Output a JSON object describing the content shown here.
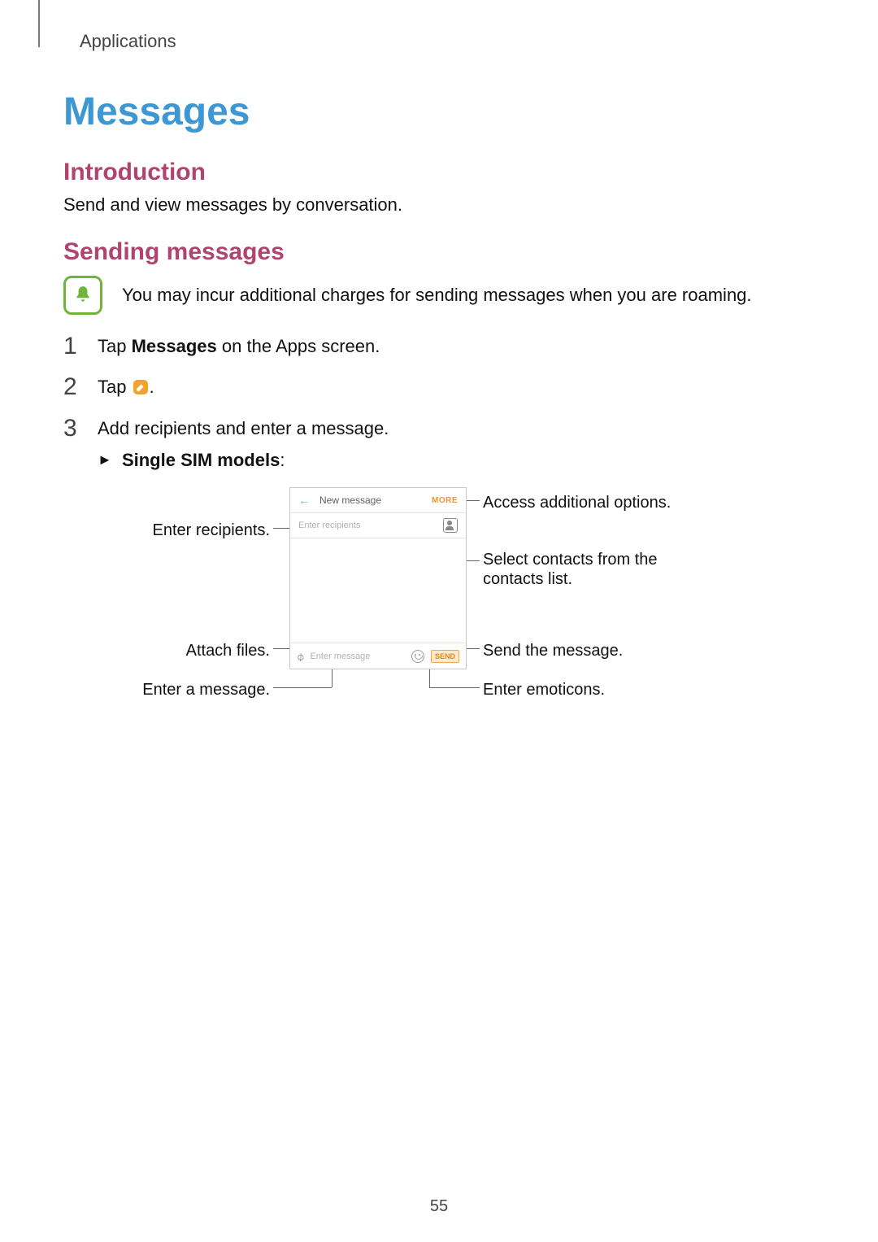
{
  "breadcrumb": "Applications",
  "h1": "Messages",
  "intro": {
    "heading": "Introduction",
    "body": "Send and view messages by conversation."
  },
  "sending": {
    "heading": "Sending messages",
    "note": "You may incur additional charges for sending messages when you are roaming.",
    "steps": {
      "s1": {
        "num": "1",
        "pre": "Tap ",
        "bold": "Messages",
        "post": " on the Apps screen."
      },
      "s2": {
        "num": "2",
        "pre": "Tap ",
        "post": "."
      },
      "s3": {
        "num": "3",
        "text": "Add recipients and enter a message."
      }
    },
    "sub": {
      "tri": "►",
      "bold": "Single SIM models",
      "colon": ":"
    }
  },
  "phone": {
    "title": "New message",
    "more": "MORE",
    "recipients_ph": "Enter recipients",
    "message_ph": "Enter message",
    "send": "SEND"
  },
  "callouts": {
    "enter_recipients": "Enter recipients.",
    "attach_files": "Attach files.",
    "enter_message": "Enter a message.",
    "more_options": "Access additional options.",
    "select_contacts_1": "Select contacts from the",
    "select_contacts_2": "contacts list.",
    "send_msg": "Send the message.",
    "enter_emoticons": "Enter emoticons."
  },
  "page_number": "55"
}
